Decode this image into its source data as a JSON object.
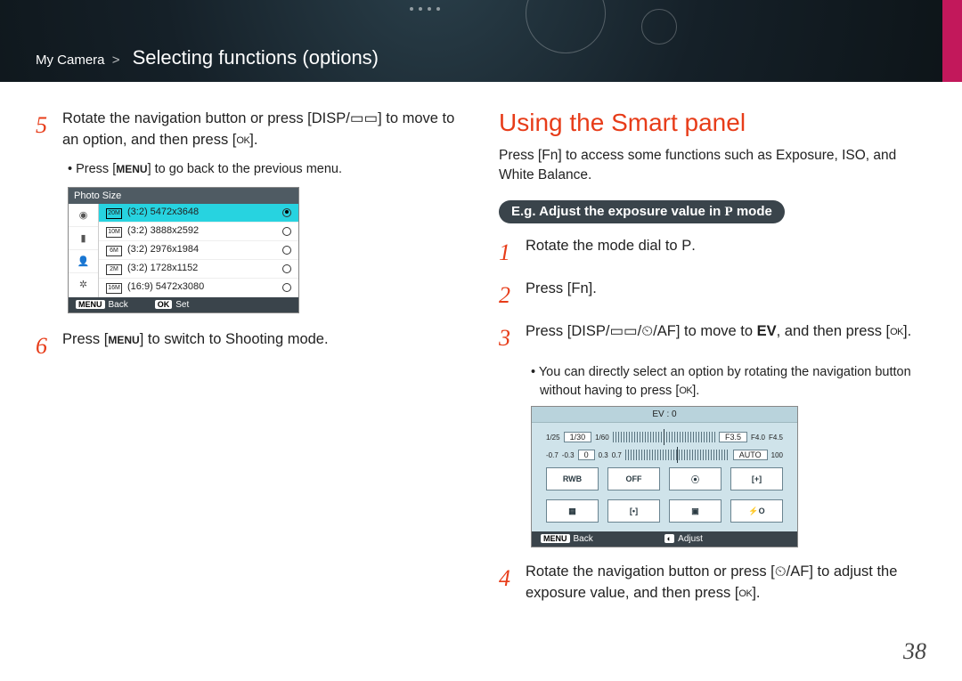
{
  "breadcrumb": {
    "root": "My Camera",
    "section": "Selecting functions (options)"
  },
  "left": {
    "step5": {
      "num": "5",
      "text_a": "Rotate the navigation button or press [",
      "disp": "DISP",
      "sep": "/",
      "icon2_name": "burst-drive-icon",
      "text_b": "] to move to an option, and then press [",
      "ok": "OK",
      "text_c": "]."
    },
    "step5_bullet": {
      "a": "Press [",
      "menu": "MENU",
      "b": "] to go back to the previous menu."
    },
    "photoSize": {
      "title": "Photo Size",
      "side_icons": [
        "camera-icon",
        "video-icon",
        "user-icon",
        "gear-icon"
      ],
      "rows": [
        {
          "label": "(3:2) 5472x3648",
          "selected": true
        },
        {
          "label": "(3:2) 3888x2592",
          "selected": false
        },
        {
          "label": "(3:2) 2976x1984",
          "selected": false
        },
        {
          "label": "(3:2) 1728x1152",
          "selected": false
        },
        {
          "label": "(16:9) 5472x3080",
          "selected": false
        }
      ],
      "foot_back_tag": "MENU",
      "foot_back": "Back",
      "foot_set_tag": "OK",
      "foot_set": "Set"
    },
    "step6": {
      "num": "6",
      "a": "Press [",
      "menu": "MENU",
      "b": "] to switch to Shooting mode."
    }
  },
  "right": {
    "heading": "Using the Smart panel",
    "intro_a": "Press [",
    "fn": "Fn",
    "intro_b": "] to access some functions such as Exposure, ISO, and White Balance.",
    "pill_a": "E.g. Adjust the exposure value in ",
    "pill_mode": "P",
    "pill_b": " mode",
    "step1": {
      "num": "1",
      "a": "Rotate the mode dial to ",
      "mode": "P",
      "b": "."
    },
    "step2": {
      "num": "2",
      "a": "Press [",
      "fn": "Fn",
      "b": "]."
    },
    "step3": {
      "num": "3",
      "a": "Press [",
      "disp": "DISP",
      "sep": "/",
      "b": "] to move to ",
      "ev": "EV",
      "c": ", and then press [",
      "ok": "OK",
      "d": "]."
    },
    "step3_sub": {
      "a": "You can directly select an option by rotating the navigation button without having to press [",
      "ok": "OK",
      "b": "]."
    },
    "smartPanel": {
      "head": "EV : 0",
      "left_vals": [
        "1/25",
        "1/60"
      ],
      "left_box": "1/30",
      "right_vals": [
        "F4.0",
        "F4.5"
      ],
      "right_box": "F3.5",
      "row2_left": [
        "-0.7",
        "-0.3",
        "0",
        "0.3",
        "0.7"
      ],
      "row2_right": [
        "AUTO",
        "100"
      ],
      "cells": [
        "RWB",
        "OFF",
        "⦿",
        "[+]",
        "▦",
        "[•]",
        "▣",
        "⚡O"
      ],
      "foot_back_tag": "MENU",
      "foot_back": "Back",
      "foot_adj_tag": "◐",
      "foot_adj": "Adjust"
    },
    "step4": {
      "num": "4",
      "a": "Rotate the navigation button or press [",
      "timer": "⏲",
      "sep": "/",
      "af": "AF",
      "b": "] to adjust the exposure value, and then press [",
      "ok": "OK",
      "c": "]."
    }
  },
  "pageNumber": "38"
}
